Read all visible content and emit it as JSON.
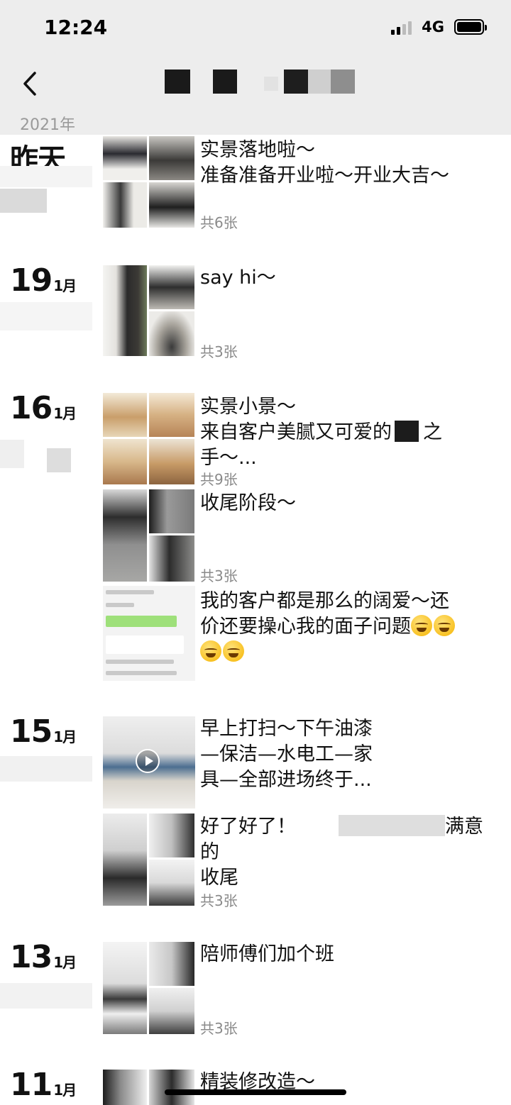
{
  "status": {
    "time": "12:24",
    "network": "4G"
  },
  "year": "2021年",
  "posts": {
    "p1": {
      "date_label": "昨天",
      "lines": [
        "实景落地啦～",
        "准备准备开业啦～开业大吉～"
      ],
      "count": "共6张"
    },
    "p2": {
      "day": "19",
      "month": "1月",
      "lines": [
        "say hi～"
      ],
      "count": "共3张"
    },
    "p3": {
      "day": "16",
      "month": "1月",
      "lines": [
        "实景小景～",
        "来自客户美腻又可爱的",
        "之",
        "手～..."
      ],
      "count": "共9张"
    },
    "p4": {
      "lines": [
        "收尾阶段～"
      ],
      "count": "共3张"
    },
    "p5": {
      "lines": [
        "我的客户都是那么的阔爱～还",
        "价还要操心我的面子问题"
      ]
    },
    "p6": {
      "day": "15",
      "month": "1月",
      "lines": [
        "早上打扫～下午油漆",
        "—保洁—水电工—家",
        "具—全部进场终于..."
      ]
    },
    "p7": {
      "lines": [
        "好了好了！",
        "满意的",
        "收尾"
      ],
      "count": "共3张"
    },
    "p8": {
      "day": "13",
      "month": "1月",
      "lines": [
        "陪师傅们加个班"
      ],
      "count": "共3张"
    },
    "p9": {
      "day": "11",
      "month": "1月",
      "lines": [
        "精装修改造～"
      ]
    }
  },
  "icons": {
    "back": "chevron-left-icon",
    "play": "play-icon",
    "emoji": "crying-laughing-emoji-icon"
  },
  "colors": {
    "header_bg": "#ededed",
    "count_text": "#8a8a8a",
    "year_text": "#9a9a9a"
  }
}
